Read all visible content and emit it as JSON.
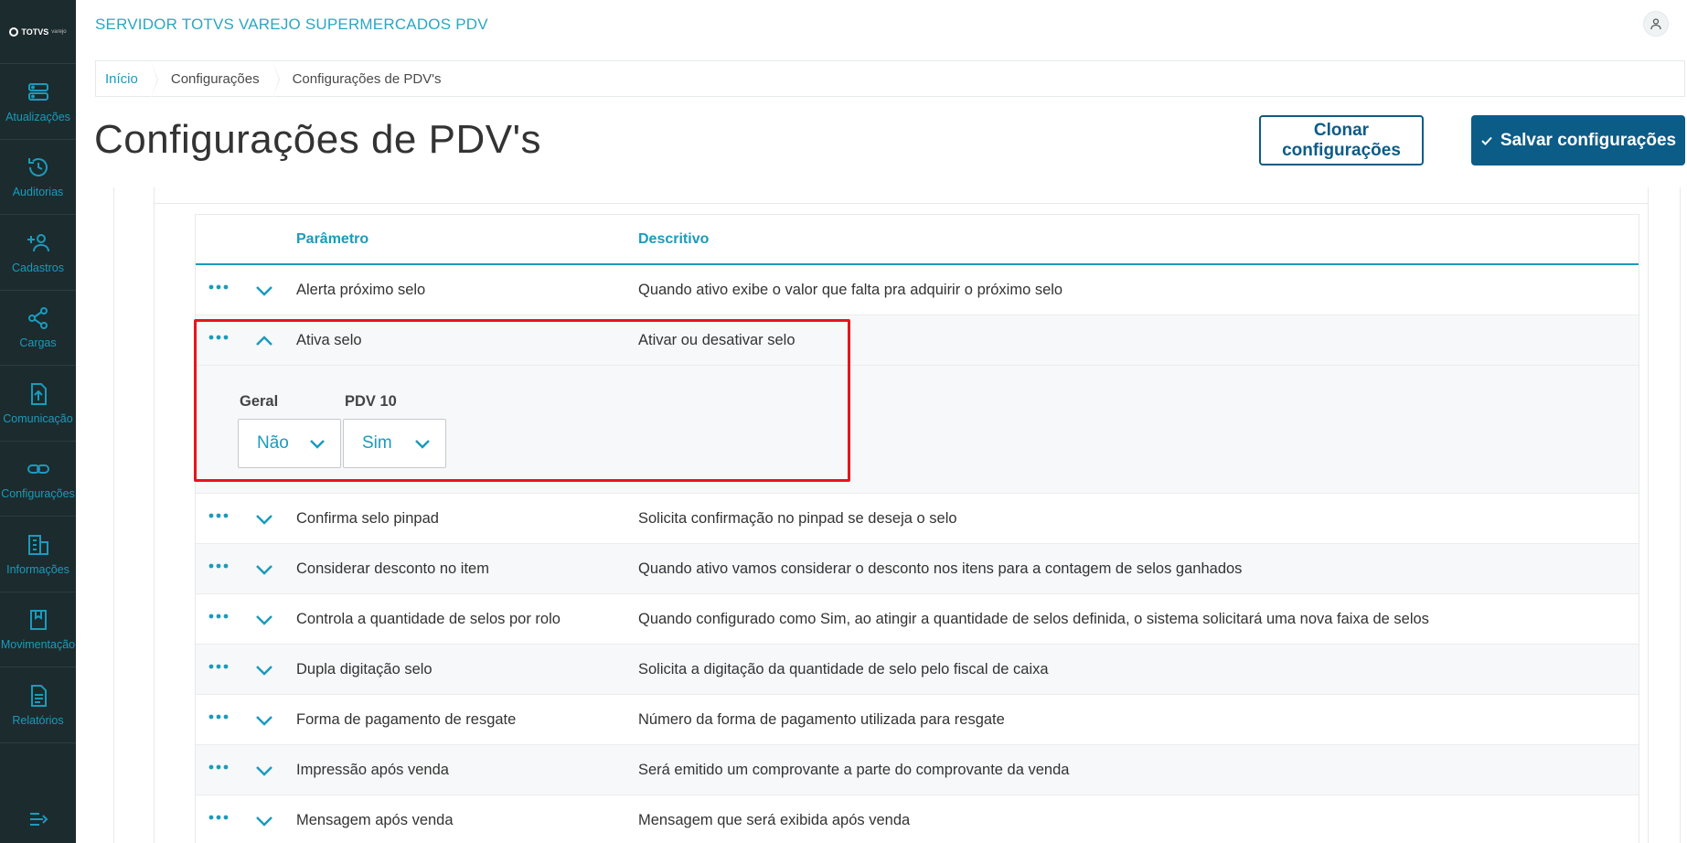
{
  "app": {
    "logo_text": "TOTVS",
    "logo_sub": "varejo",
    "title": "SERVIDOR TOTVS VAREJO SUPERMERCADOS PDV"
  },
  "sidebar": {
    "items": [
      {
        "label": "Atualizações",
        "icon": "server-icon"
      },
      {
        "label": "Auditorias",
        "icon": "history-icon"
      },
      {
        "label": "Cadastros",
        "icon": "add-user-icon"
      },
      {
        "label": "Cargas",
        "icon": "share-icon"
      },
      {
        "label": "Comunicação",
        "icon": "upload-file-icon"
      },
      {
        "label": "Configurações",
        "icon": "link-icon"
      },
      {
        "label": "Informações",
        "icon": "building-icon"
      },
      {
        "label": "Movimentação",
        "icon": "book-icon"
      },
      {
        "label": "Relatórios",
        "icon": "document-icon"
      }
    ]
  },
  "breadcrumb": {
    "items": [
      "Início",
      "Configurações",
      "Configurações de PDV's"
    ]
  },
  "page": {
    "title": "Configurações de PDV's"
  },
  "actions": {
    "clone_label": "Clonar configurações",
    "save_label": "Salvar configurações"
  },
  "table": {
    "headers": {
      "param": "Parâmetro",
      "desc": "Descritivo"
    },
    "rows": [
      {
        "param": "Alerta próximo selo",
        "desc": "Quando ativo exibe o valor que falta pra adquirir o próximo selo"
      },
      {
        "param": "Ativa selo",
        "desc": "Ativar ou desativar selo"
      },
      {
        "param": "Confirma selo pinpad",
        "desc": "Solicita confirmação no pinpad se deseja o selo"
      },
      {
        "param": "Considerar desconto no item",
        "desc": "Quando ativo vamos considerar o desconto nos itens para a contagem de selos ganhados"
      },
      {
        "param": "Controla a quantidade de selos por rolo",
        "desc": "Quando configurado como Sim, ao atingir a quantidade de selos definida, o sistema solicitará uma nova faixa de selos"
      },
      {
        "param": "Dupla digitação selo",
        "desc": "Solicita a digitação da quantidade de selo pelo fiscal de caixa"
      },
      {
        "param": "Forma de pagamento de resgate",
        "desc": "Número da forma de pagamento utilizada para resgate"
      },
      {
        "param": "Impressão após venda",
        "desc": "Será emitido um comprovante a parte do comprovante da venda"
      },
      {
        "param": "Mensagem após venda",
        "desc": "Mensagem que será exibida após venda"
      }
    ],
    "expanded": {
      "general_label": "Geral",
      "general_value": "Não",
      "pdv_label": "PDV 10",
      "pdv_value": "Sim"
    }
  },
  "colors": {
    "accent": "#1a9bbd",
    "primary": "#0c5c88",
    "sidebar_bg": "#1c2b2d",
    "highlight": "#e8141b"
  }
}
